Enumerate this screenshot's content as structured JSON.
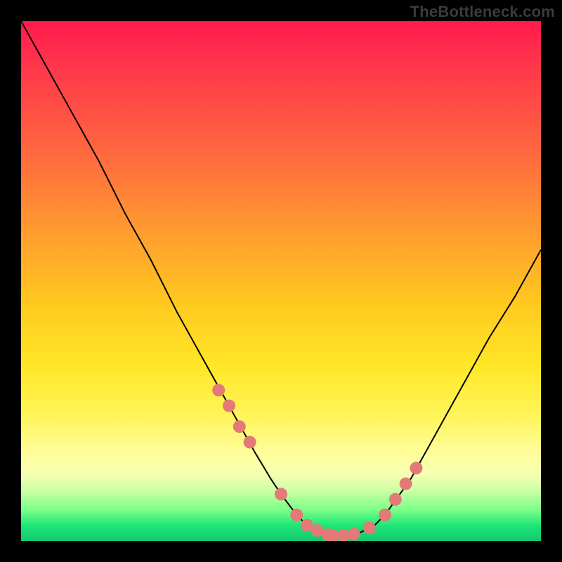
{
  "watermark": "TheBottleneck.com",
  "colors": {
    "frame": "#000000",
    "curve": "#000000",
    "marker": "#e47a78",
    "gradient_stops": [
      "#ff1a4d",
      "#ff3a4a",
      "#ff6a3e",
      "#ff9a30",
      "#ffc81f",
      "#ffe626",
      "#fff55a",
      "#fffd9a",
      "#f6ffb0",
      "#d2ffa6",
      "#7cff88",
      "#1fe676",
      "#12c96e"
    ]
  },
  "chart_data": {
    "type": "line",
    "title": "",
    "xlabel": "",
    "ylabel": "",
    "xlim": [
      0,
      100
    ],
    "ylim": [
      0,
      100
    ],
    "grid": false,
    "legend": false,
    "series": [
      {
        "name": "bottleneck-curve",
        "x": [
          0,
          5,
          10,
          15,
          20,
          25,
          30,
          35,
          40,
          45,
          48,
          50,
          53,
          55,
          58,
          60,
          62,
          65,
          68,
          70,
          75,
          80,
          85,
          90,
          95,
          100
        ],
        "y": [
          100,
          91,
          82,
          73,
          63,
          54,
          44,
          35,
          26,
          17,
          12,
          9,
          5,
          3,
          1.5,
          1,
          1,
          1.5,
          3,
          5,
          12,
          21,
          30,
          39,
          47,
          56
        ]
      }
    ],
    "markers": {
      "name": "highlight-points",
      "x": [
        38,
        40,
        42,
        44,
        50,
        53,
        55,
        57,
        59,
        60,
        62,
        64,
        67,
        70,
        72,
        74,
        76
      ],
      "y": [
        29,
        26,
        22,
        19,
        9,
        5,
        3,
        2,
        1.2,
        1,
        1,
        1.3,
        2.5,
        5,
        8,
        11,
        14
      ]
    }
  }
}
